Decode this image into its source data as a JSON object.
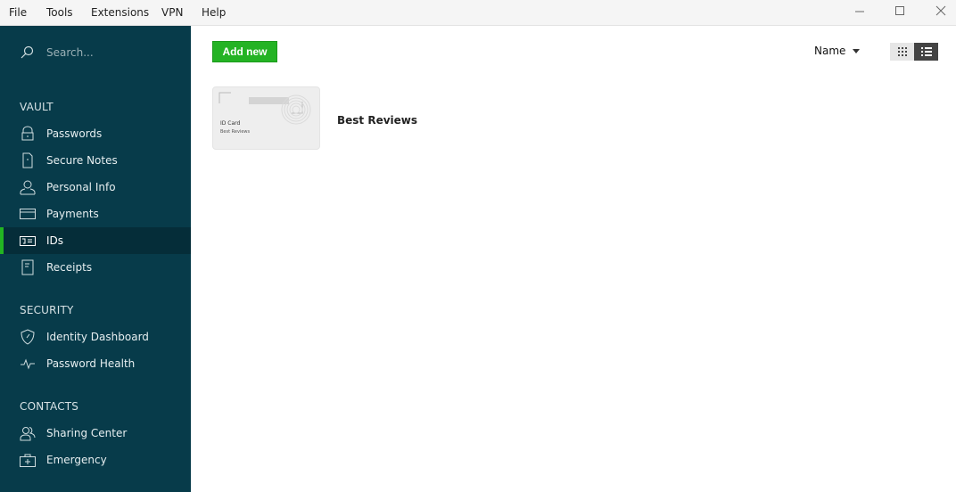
{
  "menubar": {
    "items": [
      "File",
      "Tools",
      "Extensions",
      "VPN",
      "Help"
    ],
    "window_controls": [
      "minimize-icon",
      "maximize-icon",
      "close-icon"
    ]
  },
  "sidebar": {
    "search_placeholder": "Search...",
    "sections": {
      "vault": "VAULT",
      "security": "SECURITY",
      "contacts": "CONTACTS"
    },
    "vault_items": [
      {
        "label": "Passwords",
        "icon": "lock-icon"
      },
      {
        "label": "Secure Notes",
        "icon": "note-icon"
      },
      {
        "label": "Personal Info",
        "icon": "person-icon"
      },
      {
        "label": "Payments",
        "icon": "credit-card-icon"
      },
      {
        "label": "IDs",
        "icon": "id-card-icon",
        "active": true
      },
      {
        "label": "Receipts",
        "icon": "receipt-icon"
      }
    ],
    "security_items": [
      {
        "label": "Identity Dashboard",
        "icon": "shield-icon"
      },
      {
        "label": "Password Health",
        "icon": "pulse-icon"
      }
    ],
    "contacts_items": [
      {
        "label": "Sharing Center",
        "icon": "people-icon"
      },
      {
        "label": "Emergency",
        "icon": "first-aid-kit-icon"
      }
    ]
  },
  "main": {
    "add_button": "Add new",
    "sort_by": "Name",
    "view_modes": [
      "grid",
      "list"
    ],
    "active_view": "list",
    "items": [
      {
        "card_type": "ID Card",
        "card_subtitle": "Best Reviews",
        "name": "Best Reviews"
      }
    ]
  },
  "colors": {
    "sidebar_bg": "#073b4a",
    "sidebar_active_bg": "#052d39",
    "accent_green": "#24b324"
  }
}
